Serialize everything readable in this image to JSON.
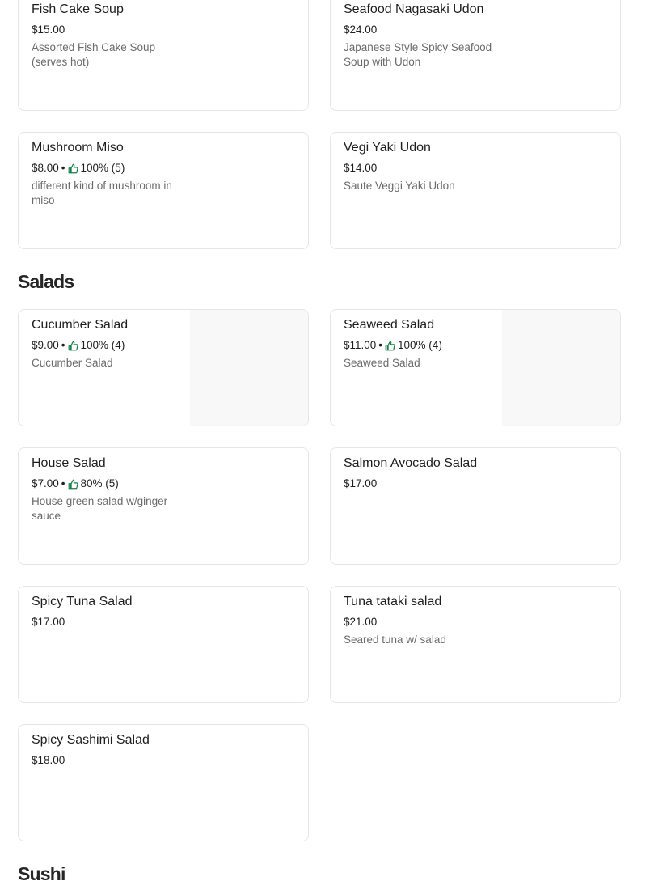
{
  "cards_top": [
    {
      "name": "Fish Cake Soup",
      "price": "$15.00",
      "rating": "",
      "desc": "Assorted Fish Cake Soup (serves hot)"
    },
    {
      "name": "Seafood Nagasaki Udon",
      "price": "$24.00",
      "rating": "",
      "desc": "Japanese Style Spicy Seafood Soup with Udon"
    },
    {
      "name": "Mushroom Miso",
      "price": "$8.00",
      "rating": "100% (5)",
      "desc": "different kind of mushroom in miso"
    },
    {
      "name": "Vegi Yaki Udon",
      "price": "$14.00",
      "rating": "",
      "desc": "Saute Veggi Yaki Udon"
    }
  ],
  "sections": {
    "salads": "Salads",
    "sushi": "Sushi"
  },
  "salads": [
    {
      "name": "Cucumber Salad",
      "price": "$9.00",
      "rating": "100% (4)",
      "desc": "Cucumber Salad"
    },
    {
      "name": "Seaweed Salad",
      "price": "$11.00",
      "rating": "100% (4)",
      "desc": "Seaweed Salad"
    },
    {
      "name": "House Salad",
      "price": "$7.00",
      "rating": "80% (5)",
      "desc": "House green salad w/ginger sauce"
    },
    {
      "name": "Salmon Avocado Salad",
      "price": "$17.00",
      "rating": "",
      "desc": ""
    },
    {
      "name": "Spicy Tuna Salad",
      "price": "$17.00",
      "rating": "",
      "desc": ""
    },
    {
      "name": "Tuna tataki salad",
      "price": "$21.00",
      "rating": "",
      "desc": "Seared tuna w/ salad"
    },
    {
      "name": "Spicy Sashimi Salad",
      "price": "$18.00",
      "rating": "",
      "desc": ""
    }
  ],
  "meta_separator": "•",
  "icons": {
    "rating": "thumbs-up-icon"
  },
  "colors": {
    "rating_icon": "#0e8345",
    "border": "#e6e6e6",
    "thumb_bg": "#f8f8f8"
  }
}
